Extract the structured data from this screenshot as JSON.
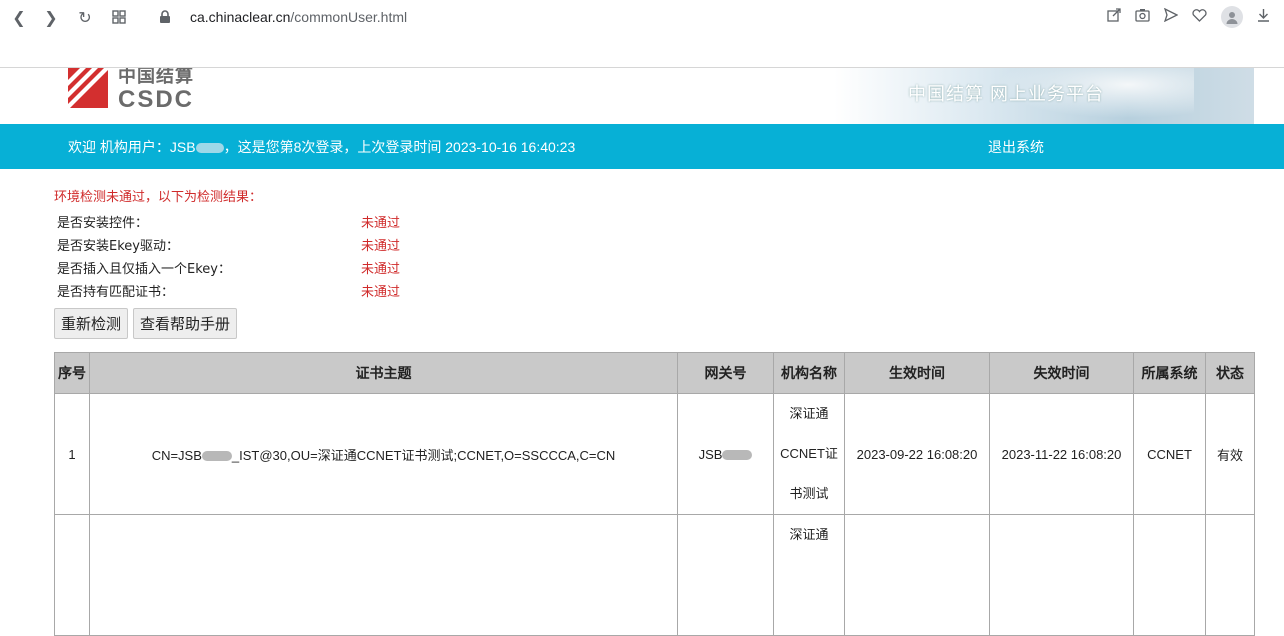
{
  "browser": {
    "url_host": "ca.chinaclear.cn",
    "url_path": "/commonUser.html"
  },
  "header": {
    "logo_cn": "中国结算",
    "logo_en": "CSDC",
    "banner_title": "中国结算 网上业务平台",
    "brand_color": "#d32f2f"
  },
  "welcome": {
    "prefix": "欢迎 机构用户：JSB",
    "suffix": "，这是您第8次登录，上次登录时间 2023-10-16 16:40:23",
    "logout": "退出系统",
    "bar_color": "#07b0d6"
  },
  "env_check": {
    "title": "环境检测未通过，以下为检测结果：",
    "items": [
      {
        "label": "是否安装控件：",
        "value": "未通过"
      },
      {
        "label": "是否安装Ekey驱动：",
        "value": "未通过"
      },
      {
        "label": "是否插入且仅插入一个Ekey：",
        "value": "未通过"
      },
      {
        "label": "是否持有匹配证书：",
        "value": "未通过"
      }
    ],
    "recheck_button": "重新检测",
    "help_button": "查看帮助手册"
  },
  "table": {
    "headers": [
      "序号",
      "证书主题",
      "网关号",
      "机构名称",
      "生效时间",
      "失效时间",
      "所属系统",
      "状态"
    ],
    "rows": [
      {
        "index": "1",
        "subject_prefix": "CN=JSB",
        "subject_suffix": "_IST@30,OU=深证通CCNET证书测试;CCNET,O=SSCCCA,C=CN",
        "gateway": "JSB",
        "org_lines": [
          "深证通",
          "CCNET证",
          "书测试"
        ],
        "start": "2023-09-22 16:08:20",
        "end": "2023-11-22 16:08:20",
        "system": "CCNET",
        "status": "有效"
      },
      {
        "index": "",
        "subject_prefix": "",
        "subject_suffix": "",
        "gateway": "",
        "org_lines": [
          "深证通"
        ],
        "start": "",
        "end": "",
        "system": "",
        "status": ""
      }
    ]
  }
}
